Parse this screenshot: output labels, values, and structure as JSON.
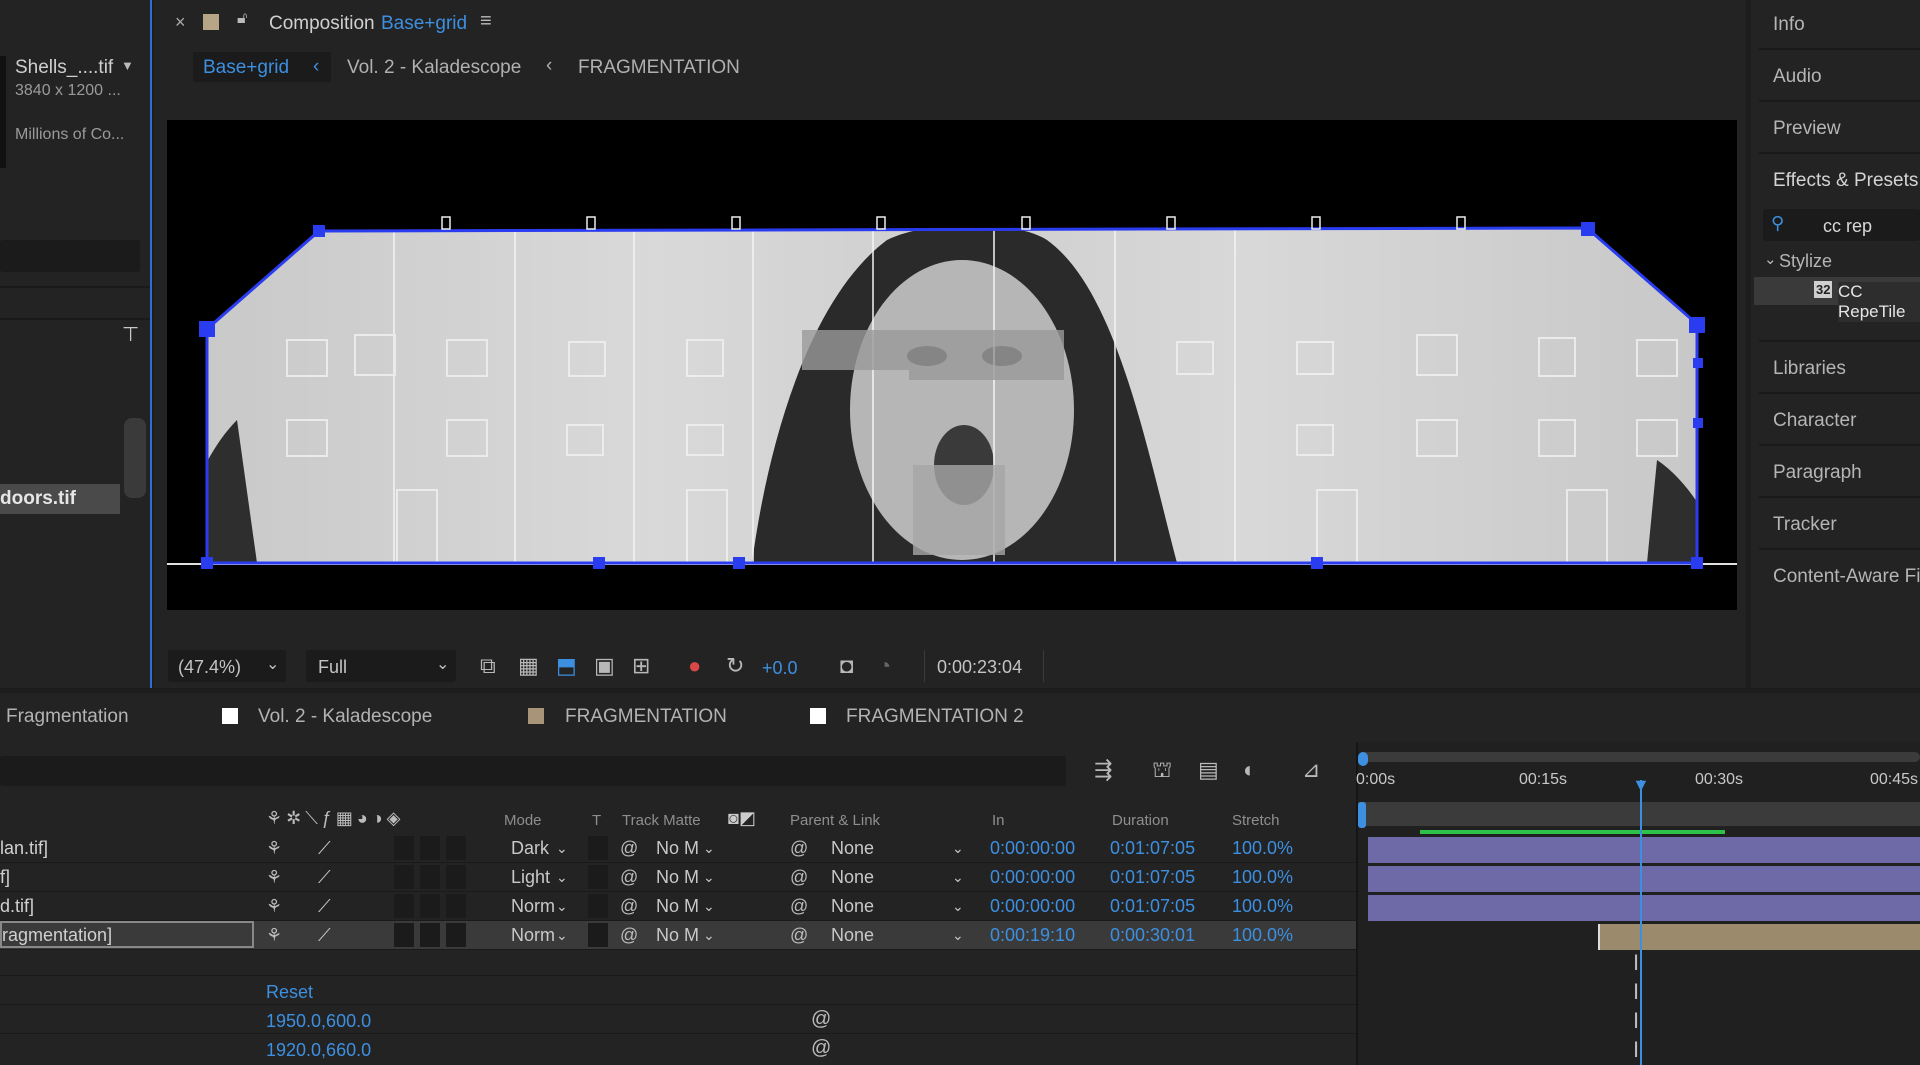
{
  "project": {
    "item_name": "Shells_....tif",
    "item_dims": "3840 x 1200 ...",
    "item_colors": "Millions of Co...",
    "selected_file": "doors.tif"
  },
  "comp": {
    "title_prefix": "Composition",
    "title_name": "Base+grid",
    "breadcrumbs": [
      "Base+grid",
      "Vol. 2 - Kaladescope",
      "FRAGMENTATION"
    ],
    "zoom": "(47.4%)",
    "resolution": "Full",
    "exposure": "+0.0",
    "timecode": "0:00:23:04"
  },
  "right_panel": {
    "items": [
      "Info",
      "Audio",
      "Preview",
      "Effects & Presets"
    ],
    "search_value": "cc rep",
    "category": "Stylize",
    "effect_name": "CC RepeTile",
    "effect_badge": "32",
    "items2": [
      "Libraries",
      "Character",
      "Paragraph",
      "Tracker",
      "Content-Aware Fill"
    ]
  },
  "timeline": {
    "tabs": [
      {
        "label": "Fragmentation",
        "color": ""
      },
      {
        "label": "Vol. 2 - Kaladescope",
        "color": "#ffffff"
      },
      {
        "label": "FRAGMENTATION",
        "color": "#a89478"
      },
      {
        "label": "FRAGMENTATION 2",
        "color": "#ffffff"
      }
    ],
    "headers": {
      "mode": "Mode",
      "t": "T",
      "track_matte": "Track Matte",
      "parent": "Parent & Link",
      "in": "In",
      "duration": "Duration",
      "stretch": "Stretch"
    },
    "ruler": [
      "0:00s",
      "00:15s",
      "00:30s",
      "00:45s"
    ],
    "layers": [
      {
        "name": "lan.tif]",
        "mode": "Dark",
        "matte": "No M",
        "parent": "None",
        "in": "0:00:00:00",
        "duration": "0:01:07:05",
        "stretch": "100.0%"
      },
      {
        "name": "f]",
        "mode": "Light",
        "matte": "No M",
        "parent": "None",
        "in": "0:00:00:00",
        "duration": "0:01:07:05",
        "stretch": "100.0%"
      },
      {
        "name": "d.tif]",
        "mode": "Norm",
        "matte": "No M",
        "parent": "None",
        "in": "0:00:00:00",
        "duration": "0:01:07:05",
        "stretch": "100.0%"
      },
      {
        "name": "ragmentation]",
        "mode": "Norm",
        "matte": "No M",
        "parent": "None",
        "in": "0:00:19:10",
        "duration": "0:00:30:01",
        "stretch": "100.0%"
      }
    ],
    "reset_label": "Reset",
    "prop_values": [
      "1950.0,600.0",
      "1920.0,660.0"
    ]
  },
  "colors": {
    "accent": "#3d8fe0",
    "selection": "#2a3cf0",
    "layer_bar": "#6e6aa8",
    "precomp_bar": "#9c8a6c",
    "work_area": "#2ec24a"
  }
}
